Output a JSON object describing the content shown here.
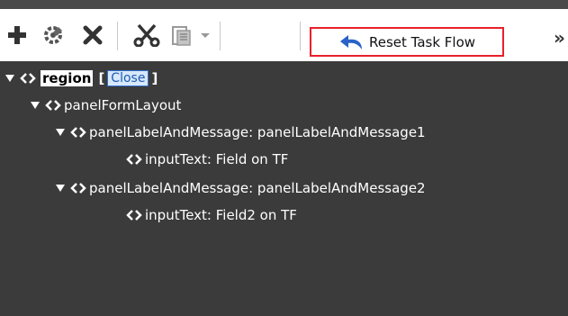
{
  "toolbar": {
    "icons": [
      "add-icon",
      "gear-icon",
      "delete-icon",
      "cut-icon",
      "paste-icon",
      "chevron-down-icon"
    ],
    "reset_label": "Reset Task Flow",
    "more_label": "»"
  },
  "tree": {
    "root": {
      "label": "region",
      "open_bracket": "[",
      "close_link": "Close",
      "close_bracket": "]"
    },
    "nodes": [
      {
        "label": "panelFormLayout"
      },
      {
        "label": "panelLabelAndMessage: panelLabelAndMessage1"
      },
      {
        "label": "inputText: Field on TF"
      },
      {
        "label": "panelLabelAndMessage: panelLabelAndMessage2"
      },
      {
        "label": "inputText: Field2 on TF"
      }
    ]
  },
  "colors": {
    "tree_bg": "#3b3b3b",
    "highlight_border": "#e8202c",
    "reset_arrow": "#2a62c9"
  }
}
